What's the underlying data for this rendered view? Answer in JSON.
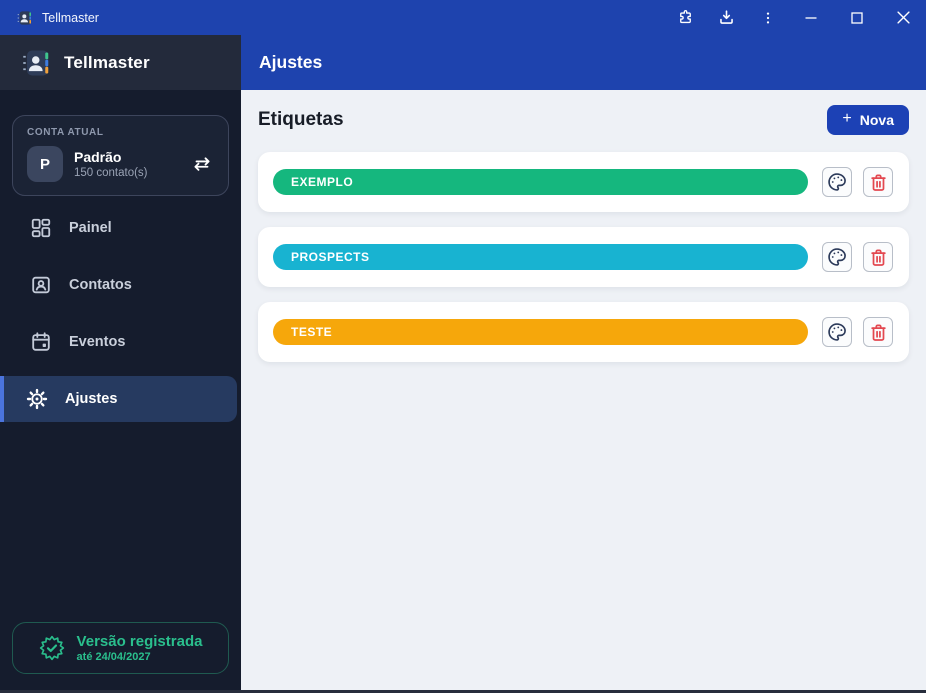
{
  "titlebar": {
    "title": "Tellmaster"
  },
  "sidebar": {
    "brand": "Tellmaster",
    "account": {
      "section_label": "CONTA ATUAL",
      "avatar_initial": "P",
      "name": "Padrão",
      "contacts_count": "150 contato(s)"
    },
    "nav": [
      {
        "label": "Painel",
        "icon": "dashboard-icon",
        "active": false
      },
      {
        "label": "Contatos",
        "icon": "contacts-icon",
        "active": false
      },
      {
        "label": "Eventos",
        "icon": "calendar-icon",
        "active": false
      },
      {
        "label": "Ajustes",
        "icon": "gear-icon",
        "active": true
      }
    ],
    "license": {
      "title": "Versão registrada",
      "subtitle": "até 24/04/2027",
      "icon": "badge-check"
    }
  },
  "main": {
    "header_title": "Ajustes",
    "section_title": "Etiquetas",
    "new_button": {
      "label": "Nova",
      "plus": "+"
    },
    "labels": [
      {
        "name": "EXEMPLO",
        "color": "#15b77e"
      },
      {
        "name": "PROSPECTS",
        "color": "#18b3d1"
      },
      {
        "name": "TESTE",
        "color": "#f6a70b"
      }
    ],
    "row_actions": {
      "edit_color": "palette-icon",
      "delete": "trash-icon"
    }
  },
  "icons": {
    "app-icon": "address-book",
    "extensions-icon": "puzzle-piece",
    "download-icon": "tray-arrow-down",
    "menu-kebab-icon": "kebab-vertical",
    "minimize-icon": "minus",
    "maximize-icon": "square-outline",
    "close-icon": "x",
    "account-switch-icon": "⇄",
    "badge-check-icon": "seal-check"
  },
  "colors": {
    "titlebar_blue": "#1e43ae",
    "sidebar_bg": "#151c2d",
    "sidebar_header_bg": "#232a3b",
    "active_nav_bg": "#263a60",
    "active_nav_accent": "#4b74dd",
    "license_green": "#2abf8d",
    "content_bg": "#eef1f6",
    "new_button_blue": "#1c41b5",
    "delete_red": "#e34850",
    "palette_navy": "#2c3a5a"
  }
}
